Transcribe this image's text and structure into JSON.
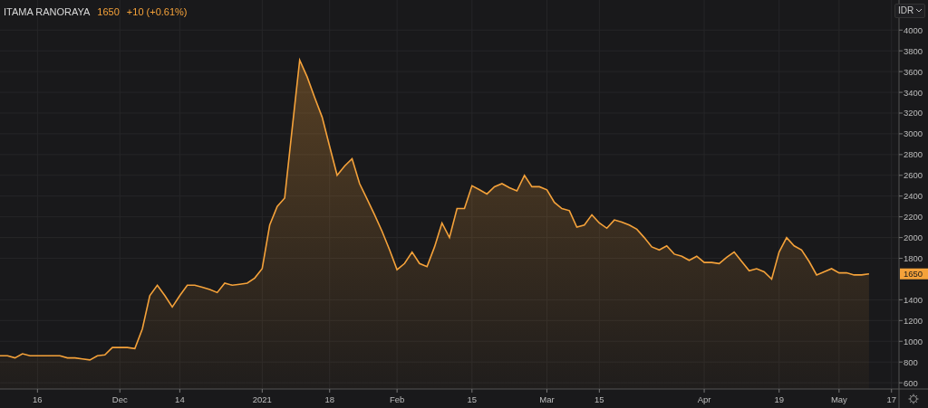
{
  "header": {
    "symbol": "ITAMA RANORAYA",
    "price": "1650",
    "change": "+10 (+0.61%)"
  },
  "currency": "IDR",
  "price_label": "1650",
  "chart_data": {
    "type": "area",
    "grid": true,
    "ylim": [
      540,
      4290
    ],
    "categories": [
      null,
      null,
      null,
      null,
      null,
      "16",
      null,
      null,
      null,
      null,
      null,
      null,
      null,
      null,
      null,
      null,
      "Dec",
      null,
      null,
      null,
      null,
      null,
      null,
      null,
      "14",
      null,
      null,
      null,
      null,
      null,
      null,
      null,
      null,
      null,
      null,
      "2021",
      null,
      null,
      null,
      null,
      null,
      null,
      null,
      null,
      "18",
      null,
      null,
      null,
      null,
      null,
      null,
      null,
      null,
      "Feb",
      null,
      null,
      null,
      null,
      null,
      null,
      null,
      null,
      null,
      "15",
      null,
      null,
      null,
      null,
      null,
      null,
      null,
      null,
      null,
      "Mar",
      null,
      null,
      null,
      null,
      null,
      null,
      "15",
      null,
      null,
      null,
      null,
      null,
      null,
      null,
      null,
      null,
      null,
      null,
      null,
      null,
      "Apr",
      null,
      null,
      null,
      null,
      null,
      null,
      null,
      null,
      null,
      "19",
      null,
      null,
      null,
      null,
      null,
      null,
      null,
      "May",
      null,
      null,
      null,
      null,
      null,
      null,
      "17"
    ],
    "series": [
      {
        "color": "#f5a23a",
        "values": [
          860,
          860,
          840,
          880,
          860,
          860,
          860,
          860,
          860,
          840,
          840,
          830,
          820,
          860,
          870,
          940,
          940,
          940,
          930,
          1120,
          1440,
          1540,
          1440,
          1330,
          1440,
          1540,
          1540,
          1520,
          1500,
          1470,
          1560,
          1540,
          1550,
          1560,
          1610,
          1700,
          2120,
          2300,
          2380,
          3050,
          3710,
          3550,
          3350,
          3160,
          2880,
          2600,
          2690,
          2760,
          2520,
          2370,
          2220,
          2060,
          1880,
          1690,
          1750,
          1860,
          1750,
          1720,
          1910,
          2140,
          2000,
          2280,
          2280,
          2500,
          2460,
          2420,
          2490,
          2520,
          2480,
          2450,
          2600,
          2490,
          2490,
          2460,
          2340,
          2280,
          2260,
          2100,
          2120,
          2220,
          2140,
          2090,
          2170,
          2150,
          2120,
          2080,
          2000,
          1910,
          1880,
          1920,
          1840,
          1820,
          1780,
          1820,
          1760,
          1760,
          1750,
          1810,
          1860,
          1770,
          1680,
          1700,
          1670,
          1600,
          1860,
          2000,
          1920,
          1880,
          1770,
          1640,
          1670,
          1700,
          1660,
          1660,
          1640,
          1640,
          1650,
          null,
          null,
          null
        ]
      }
    ],
    "yticks": [
      600,
      800,
      1000,
      1200,
      1400,
      1800,
      2000,
      2200,
      2400,
      2600,
      2800,
      3000,
      3200,
      3400,
      3600,
      3800,
      4000
    ]
  }
}
